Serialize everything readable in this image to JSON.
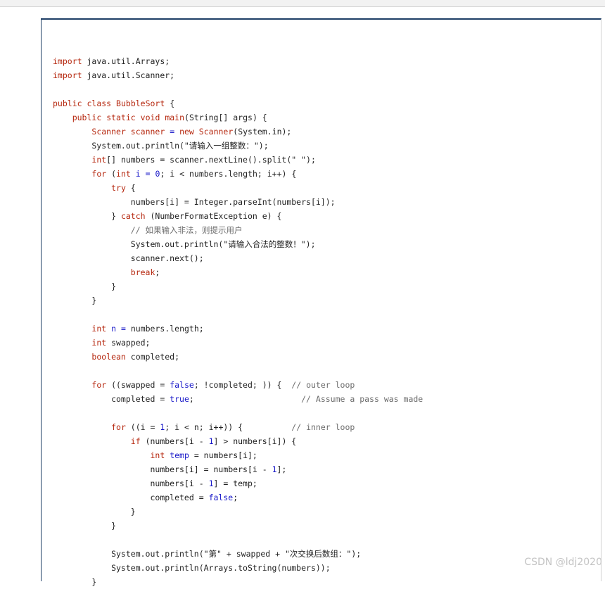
{
  "colors": {
    "keyword": "#b5260d",
    "type": "#1717c8",
    "number": "#1717c8",
    "text": "#222222",
    "string": "#222222",
    "comment": "#6b6b6b",
    "watermark": "#c4c4c4"
  },
  "code_lines": [
    [],
    [
      {
        "t": "import",
        "c": "keyword"
      },
      {
        "t": " java.util.Arrays;",
        "c": "text"
      }
    ],
    [
      {
        "t": "import",
        "c": "keyword"
      },
      {
        "t": " java.util.Scanner;",
        "c": "text"
      }
    ],
    [],
    [
      {
        "t": "public",
        "c": "keyword"
      },
      {
        "t": " ",
        "c": "text"
      },
      {
        "t": "class",
        "c": "keyword"
      },
      {
        "t": " ",
        "c": "text"
      },
      {
        "t": "BubbleSort",
        "c": "keyword"
      },
      {
        "t": " {",
        "c": "text"
      }
    ],
    [
      {
        "t": "    ",
        "c": "text"
      },
      {
        "t": "public",
        "c": "keyword"
      },
      {
        "t": " ",
        "c": "text"
      },
      {
        "t": "static",
        "c": "keyword"
      },
      {
        "t": " ",
        "c": "text"
      },
      {
        "t": "void",
        "c": "keyword"
      },
      {
        "t": " ",
        "c": "text"
      },
      {
        "t": "main",
        "c": "keyword"
      },
      {
        "t": "(String[] args) {",
        "c": "text"
      }
    ],
    [
      {
        "t": "        ",
        "c": "text"
      },
      {
        "t": "Scanner",
        "c": "keyword"
      },
      {
        "t": " ",
        "c": "text"
      },
      {
        "t": "scanner",
        "c": "keyword"
      },
      {
        "t": " ",
        "c": "text"
      },
      {
        "t": "=",
        "c": "type"
      },
      {
        "t": " ",
        "c": "text"
      },
      {
        "t": "new",
        "c": "keyword"
      },
      {
        "t": " ",
        "c": "text"
      },
      {
        "t": "Scanner",
        "c": "keyword"
      },
      {
        "t": "(System.in);",
        "c": "text"
      }
    ],
    [
      {
        "t": "        System.out.println(\"请输入一组整数：\");",
        "c": "text"
      }
    ],
    [
      {
        "t": "        ",
        "c": "text"
      },
      {
        "t": "int",
        "c": "keyword"
      },
      {
        "t": "[] numbers = scanner.nextLine().split(\" \");",
        "c": "text"
      }
    ],
    [
      {
        "t": "        ",
        "c": "text"
      },
      {
        "t": "for",
        "c": "keyword"
      },
      {
        "t": " (",
        "c": "text"
      },
      {
        "t": "int",
        "c": "keyword"
      },
      {
        "t": " ",
        "c": "text"
      },
      {
        "t": "i",
        "c": "type"
      },
      {
        "t": " ",
        "c": "text"
      },
      {
        "t": "=",
        "c": "type"
      },
      {
        "t": " ",
        "c": "text"
      },
      {
        "t": "0",
        "c": "number"
      },
      {
        "t": "; i < numbers.length; i++) {",
        "c": "text"
      }
    ],
    [
      {
        "t": "            ",
        "c": "text"
      },
      {
        "t": "try",
        "c": "keyword"
      },
      {
        "t": " {",
        "c": "text"
      }
    ],
    [
      {
        "t": "                numbers[i] = Integer.parseInt(numbers[i]);",
        "c": "text"
      }
    ],
    [
      {
        "t": "            } ",
        "c": "text"
      },
      {
        "t": "catch",
        "c": "keyword"
      },
      {
        "t": " (NumberFormatException e) {",
        "c": "text"
      }
    ],
    [
      {
        "t": "                ",
        "c": "text"
      },
      {
        "t": "// 如果输入非法，则提示用户",
        "c": "comment"
      }
    ],
    [
      {
        "t": "                System.out.println(\"请输入合法的整数！\");",
        "c": "text"
      }
    ],
    [
      {
        "t": "                scanner.next();",
        "c": "text"
      }
    ],
    [
      {
        "t": "                ",
        "c": "text"
      },
      {
        "t": "break",
        "c": "keyword"
      },
      {
        "t": ";",
        "c": "text"
      }
    ],
    [
      {
        "t": "            }",
        "c": "text"
      }
    ],
    [
      {
        "t": "        }",
        "c": "text"
      }
    ],
    [],
    [
      {
        "t": "        ",
        "c": "text"
      },
      {
        "t": "int",
        "c": "keyword"
      },
      {
        "t": " ",
        "c": "text"
      },
      {
        "t": "n",
        "c": "type"
      },
      {
        "t": " ",
        "c": "text"
      },
      {
        "t": "=",
        "c": "type"
      },
      {
        "t": " numbers.length;",
        "c": "text"
      }
    ],
    [
      {
        "t": "        ",
        "c": "text"
      },
      {
        "t": "int",
        "c": "keyword"
      },
      {
        "t": " swapped;",
        "c": "text"
      }
    ],
    [
      {
        "t": "        ",
        "c": "text"
      },
      {
        "t": "boolean",
        "c": "keyword"
      },
      {
        "t": " completed;",
        "c": "text"
      }
    ],
    [],
    [
      {
        "t": "        ",
        "c": "text"
      },
      {
        "t": "for",
        "c": "keyword"
      },
      {
        "t": " ((swapped = ",
        "c": "text"
      },
      {
        "t": "false",
        "c": "type"
      },
      {
        "t": "; !completed; )) {  ",
        "c": "text"
      },
      {
        "t": "// outer loop",
        "c": "comment"
      }
    ],
    [
      {
        "t": "            completed = ",
        "c": "text"
      },
      {
        "t": "true",
        "c": "type"
      },
      {
        "t": ";                      ",
        "c": "text"
      },
      {
        "t": "// Assume a pass was made",
        "c": "comment"
      }
    ],
    [],
    [
      {
        "t": "            ",
        "c": "text"
      },
      {
        "t": "for",
        "c": "keyword"
      },
      {
        "t": " ((i = ",
        "c": "text"
      },
      {
        "t": "1",
        "c": "number"
      },
      {
        "t": "; i < n; i++)) {          ",
        "c": "text"
      },
      {
        "t": "// inner loop",
        "c": "comment"
      }
    ],
    [
      {
        "t": "                ",
        "c": "text"
      },
      {
        "t": "if",
        "c": "keyword"
      },
      {
        "t": " (numbers[i - ",
        "c": "text"
      },
      {
        "t": "1",
        "c": "number"
      },
      {
        "t": "] > numbers[i]) {",
        "c": "text"
      }
    ],
    [
      {
        "t": "                    ",
        "c": "text"
      },
      {
        "t": "int",
        "c": "keyword"
      },
      {
        "t": " ",
        "c": "text"
      },
      {
        "t": "temp",
        "c": "type"
      },
      {
        "t": " = numbers[i];",
        "c": "text"
      }
    ],
    [
      {
        "t": "                    numbers[i] = numbers[i - ",
        "c": "text"
      },
      {
        "t": "1",
        "c": "number"
      },
      {
        "t": "];",
        "c": "text"
      }
    ],
    [
      {
        "t": "                    numbers[i - ",
        "c": "text"
      },
      {
        "t": "1",
        "c": "number"
      },
      {
        "t": "] = temp;",
        "c": "text"
      }
    ],
    [
      {
        "t": "                    completed = ",
        "c": "text"
      },
      {
        "t": "false",
        "c": "type"
      },
      {
        "t": ";",
        "c": "text"
      }
    ],
    [
      {
        "t": "                }",
        "c": "text"
      }
    ],
    [
      {
        "t": "            }",
        "c": "text"
      }
    ],
    [],
    [
      {
        "t": "            System.out.println(\"第\" + swapped + \"次交换后数组：\");",
        "c": "text"
      }
    ],
    [
      {
        "t": "            System.out.println(Arrays.toString(numbers));",
        "c": "text"
      }
    ],
    [
      {
        "t": "        }",
        "c": "text"
      }
    ]
  ],
  "watermark": "CSDN @ldj2020"
}
